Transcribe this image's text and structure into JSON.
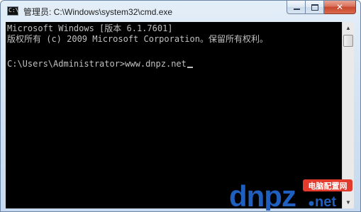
{
  "window": {
    "title": "管理员: C:\\Windows\\system32\\cmd.exe",
    "icon_glyph": "C:\\",
    "icon": "console-icon",
    "colors": {
      "console_bg": "#000000",
      "console_fg": "#c0c0c0",
      "close_button": "#c7462c",
      "frame": "#cfe0f1"
    }
  },
  "caption_buttons": {
    "minimize_icon": "minimize-icon",
    "maximize_icon": "maximize-icon",
    "close_icon": "close-icon",
    "close_glyph": "✕"
  },
  "console": {
    "lines": [
      "Microsoft Windows [版本 6.1.7601]",
      "版权所有 (c) 2009 Microsoft Corporation。保留所有权利。",
      "",
      "C:\\Users\\Administrator>www.dnpz.net"
    ]
  },
  "scrollbar": {
    "up_arrow": "▲",
    "down_arrow": "▼"
  },
  "watermark": {
    "logo_text": "dnpz.net",
    "tagline": "电脑配置网"
  }
}
